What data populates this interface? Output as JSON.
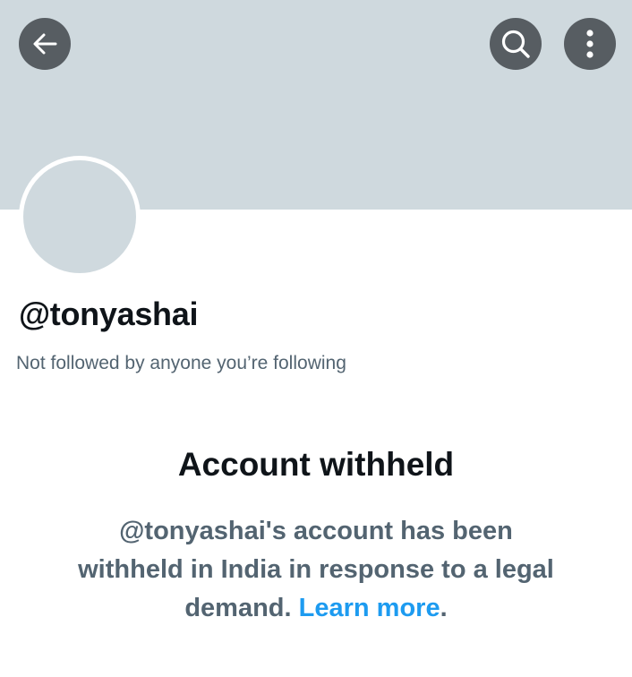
{
  "header": {
    "back_icon": "arrow-left-icon",
    "search_icon": "search-icon",
    "more_icon": "more-vertical-icon",
    "banner_color": "#cfd9de",
    "button_color": "#575d62"
  },
  "profile": {
    "handle": "@tonyashai",
    "follow_note": "Not followed by anyone you’re following"
  },
  "notice": {
    "title": "Account withheld",
    "body_line1": "@tonyashai's account has been",
    "body_line2": "withheld in India in response to a legal",
    "body_line3_prefix": "demand. ",
    "link_label": "Learn more",
    "period": ".",
    "link_color": "#1d9bf0"
  }
}
